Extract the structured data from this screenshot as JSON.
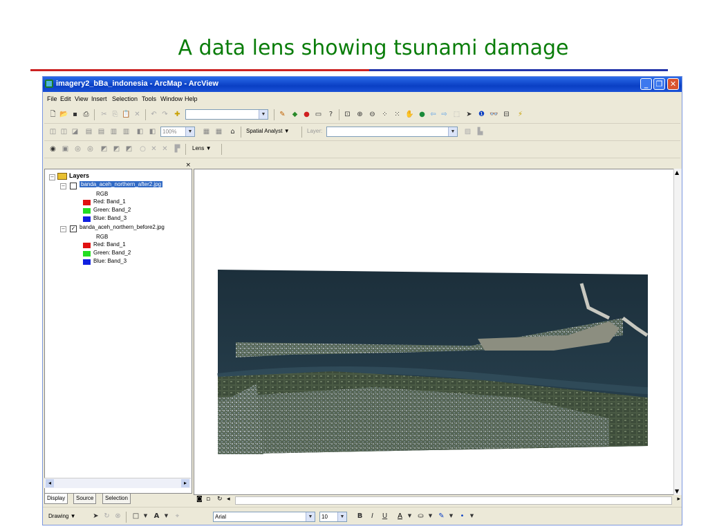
{
  "slide": {
    "title": "A data lens showing tsunami damage"
  },
  "window": {
    "title": "imagery2_bBa_indonesia - ArcMap - ArcView"
  },
  "menu": [
    "File",
    "Edit",
    "View",
    "Insert",
    "Selection",
    "Tools",
    "Window",
    "Help"
  ],
  "toolbar": {
    "scale_value": "",
    "zoom_percent": "100%",
    "spatial_analyst_label": "Spatial Analyst ▼",
    "layer_label": "Layer:",
    "lens_label": "Lens ▼"
  },
  "toc": {
    "root": "Layers",
    "layer1": {
      "name": "banda_aceh_northern_after2.jpg",
      "renderer": "RGB",
      "bands": [
        "Red:   Band_1",
        "Green: Band_2",
        "Blue:  Band_3"
      ],
      "checked": false
    },
    "layer2": {
      "name": "banda_aceh_northern_before2.jpg",
      "renderer": "RGB",
      "bands": [
        "Red:   Band_1",
        "Green: Band_2",
        "Blue:  Band_3"
      ],
      "checked": true
    },
    "band_colors": [
      "#e01010",
      "#22dd22",
      "#1020e0"
    ]
  },
  "toc_tabs": [
    "Display",
    "Source",
    "Selection"
  ],
  "drawing": {
    "drawing_label": "Drawing ▼",
    "font_name": "Arial",
    "font_size": "10"
  },
  "colors": {
    "title_green": "#0a7d0a",
    "rule_red": "#cc2222",
    "rule_blue": "#2233aa",
    "title_bar": "#0a3fc4"
  }
}
